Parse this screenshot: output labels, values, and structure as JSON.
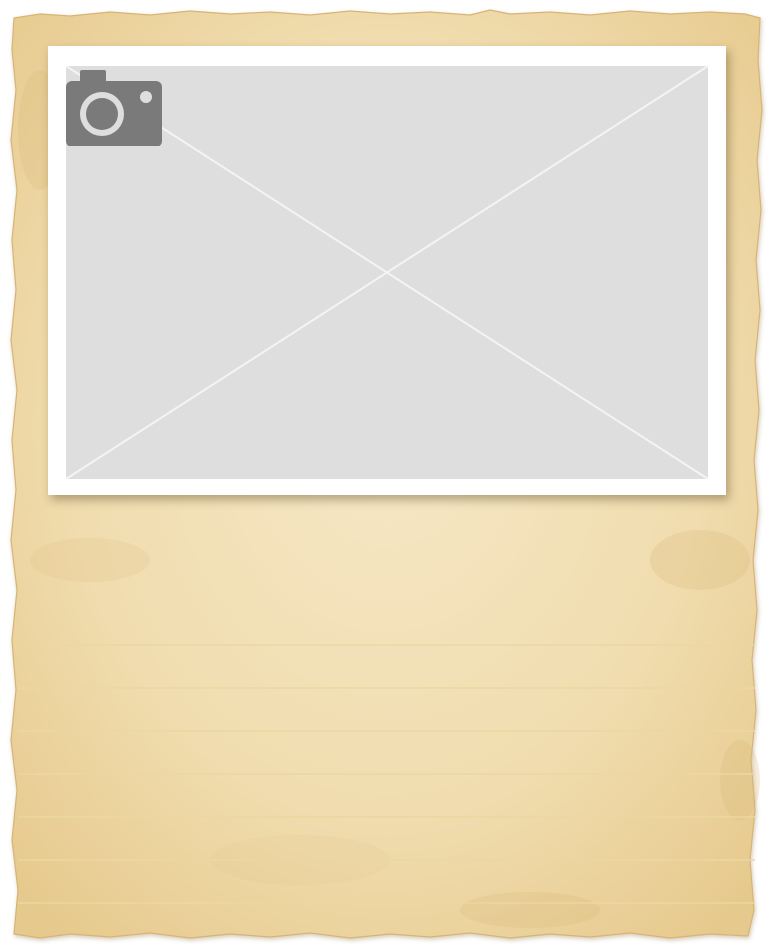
{
  "colors": {
    "paper": "#f1dfb6",
    "paper_edge": "#dcb878",
    "frame": "#ffffff",
    "placeholder": "#dedede",
    "placeholder_lines": "#f2f2f2",
    "camera": "#7a7a7a",
    "ruled_line": "#ecd7a0"
  },
  "icons": {
    "photo_placeholder": "camera-icon"
  },
  "ruled_lines": {
    "count": 7
  }
}
